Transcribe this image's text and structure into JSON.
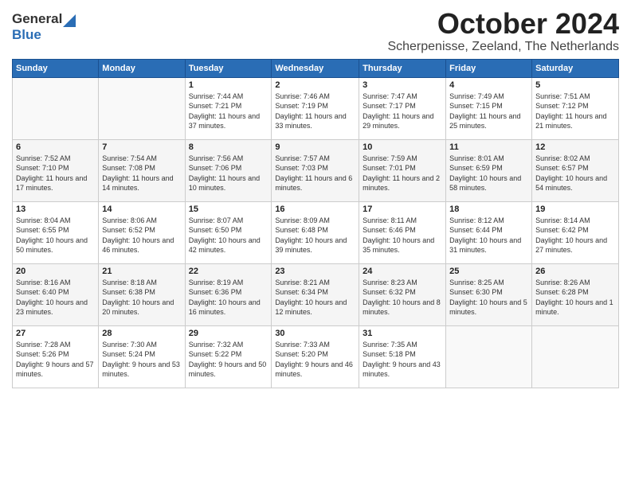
{
  "header": {
    "logo_general": "General",
    "logo_blue": "Blue",
    "month_title": "October 2024",
    "location": "Scherpenisse, Zeeland, The Netherlands"
  },
  "days_of_week": [
    "Sunday",
    "Monday",
    "Tuesday",
    "Wednesday",
    "Thursday",
    "Friday",
    "Saturday"
  ],
  "weeks": [
    [
      {
        "day": "",
        "info": ""
      },
      {
        "day": "",
        "info": ""
      },
      {
        "day": "1",
        "info": "Sunrise: 7:44 AM\nSunset: 7:21 PM\nDaylight: 11 hours\nand 37 minutes."
      },
      {
        "day": "2",
        "info": "Sunrise: 7:46 AM\nSunset: 7:19 PM\nDaylight: 11 hours\nand 33 minutes."
      },
      {
        "day": "3",
        "info": "Sunrise: 7:47 AM\nSunset: 7:17 PM\nDaylight: 11 hours\nand 29 minutes."
      },
      {
        "day": "4",
        "info": "Sunrise: 7:49 AM\nSunset: 7:15 PM\nDaylight: 11 hours\nand 25 minutes."
      },
      {
        "day": "5",
        "info": "Sunrise: 7:51 AM\nSunset: 7:12 PM\nDaylight: 11 hours\nand 21 minutes."
      }
    ],
    [
      {
        "day": "6",
        "info": "Sunrise: 7:52 AM\nSunset: 7:10 PM\nDaylight: 11 hours\nand 17 minutes."
      },
      {
        "day": "7",
        "info": "Sunrise: 7:54 AM\nSunset: 7:08 PM\nDaylight: 11 hours\nand 14 minutes."
      },
      {
        "day": "8",
        "info": "Sunrise: 7:56 AM\nSunset: 7:06 PM\nDaylight: 11 hours\nand 10 minutes."
      },
      {
        "day": "9",
        "info": "Sunrise: 7:57 AM\nSunset: 7:03 PM\nDaylight: 11 hours\nand 6 minutes."
      },
      {
        "day": "10",
        "info": "Sunrise: 7:59 AM\nSunset: 7:01 PM\nDaylight: 11 hours\nand 2 minutes."
      },
      {
        "day": "11",
        "info": "Sunrise: 8:01 AM\nSunset: 6:59 PM\nDaylight: 10 hours\nand 58 minutes."
      },
      {
        "day": "12",
        "info": "Sunrise: 8:02 AM\nSunset: 6:57 PM\nDaylight: 10 hours\nand 54 minutes."
      }
    ],
    [
      {
        "day": "13",
        "info": "Sunrise: 8:04 AM\nSunset: 6:55 PM\nDaylight: 10 hours\nand 50 minutes."
      },
      {
        "day": "14",
        "info": "Sunrise: 8:06 AM\nSunset: 6:52 PM\nDaylight: 10 hours\nand 46 minutes."
      },
      {
        "day": "15",
        "info": "Sunrise: 8:07 AM\nSunset: 6:50 PM\nDaylight: 10 hours\nand 42 minutes."
      },
      {
        "day": "16",
        "info": "Sunrise: 8:09 AM\nSunset: 6:48 PM\nDaylight: 10 hours\nand 39 minutes."
      },
      {
        "day": "17",
        "info": "Sunrise: 8:11 AM\nSunset: 6:46 PM\nDaylight: 10 hours\nand 35 minutes."
      },
      {
        "day": "18",
        "info": "Sunrise: 8:12 AM\nSunset: 6:44 PM\nDaylight: 10 hours\nand 31 minutes."
      },
      {
        "day": "19",
        "info": "Sunrise: 8:14 AM\nSunset: 6:42 PM\nDaylight: 10 hours\nand 27 minutes."
      }
    ],
    [
      {
        "day": "20",
        "info": "Sunrise: 8:16 AM\nSunset: 6:40 PM\nDaylight: 10 hours\nand 23 minutes."
      },
      {
        "day": "21",
        "info": "Sunrise: 8:18 AM\nSunset: 6:38 PM\nDaylight: 10 hours\nand 20 minutes."
      },
      {
        "day": "22",
        "info": "Sunrise: 8:19 AM\nSunset: 6:36 PM\nDaylight: 10 hours\nand 16 minutes."
      },
      {
        "day": "23",
        "info": "Sunrise: 8:21 AM\nSunset: 6:34 PM\nDaylight: 10 hours\nand 12 minutes."
      },
      {
        "day": "24",
        "info": "Sunrise: 8:23 AM\nSunset: 6:32 PM\nDaylight: 10 hours\nand 8 minutes."
      },
      {
        "day": "25",
        "info": "Sunrise: 8:25 AM\nSunset: 6:30 PM\nDaylight: 10 hours\nand 5 minutes."
      },
      {
        "day": "26",
        "info": "Sunrise: 8:26 AM\nSunset: 6:28 PM\nDaylight: 10 hours\nand 1 minute."
      }
    ],
    [
      {
        "day": "27",
        "info": "Sunrise: 7:28 AM\nSunset: 5:26 PM\nDaylight: 9 hours\nand 57 minutes."
      },
      {
        "day": "28",
        "info": "Sunrise: 7:30 AM\nSunset: 5:24 PM\nDaylight: 9 hours\nand 53 minutes."
      },
      {
        "day": "29",
        "info": "Sunrise: 7:32 AM\nSunset: 5:22 PM\nDaylight: 9 hours\nand 50 minutes."
      },
      {
        "day": "30",
        "info": "Sunrise: 7:33 AM\nSunset: 5:20 PM\nDaylight: 9 hours\nand 46 minutes."
      },
      {
        "day": "31",
        "info": "Sunrise: 7:35 AM\nSunset: 5:18 PM\nDaylight: 9 hours\nand 43 minutes."
      },
      {
        "day": "",
        "info": ""
      },
      {
        "day": "",
        "info": ""
      }
    ]
  ]
}
